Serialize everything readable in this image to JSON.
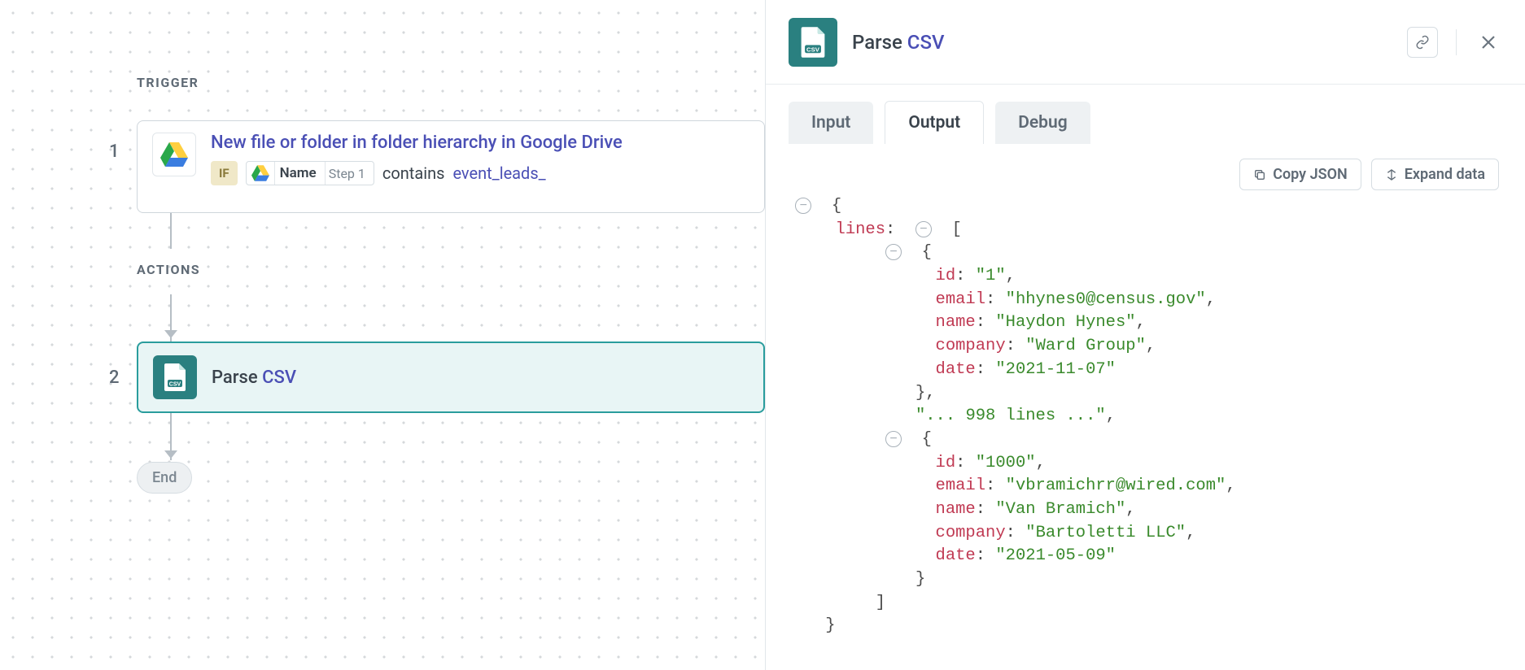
{
  "canvas": {
    "sectionTrigger": "TRIGGER",
    "sectionActions": "ACTIONS",
    "step1Num": "1",
    "step2Num": "2",
    "end": "End"
  },
  "trigger": {
    "title": "New file or folder in folder hierarchy in Google Drive",
    "ifLabel": "IF",
    "fieldName": "Name",
    "fieldStep": "Step 1",
    "operator": "contains",
    "value": "event_leads_"
  },
  "action": {
    "titlePrefix": "Parse ",
    "titleLink": "CSV"
  },
  "panel": {
    "titlePrefix": "Parse ",
    "titleLink": "CSV",
    "tabs": {
      "input": "Input",
      "output": "Output",
      "debug": "Debug"
    },
    "buttons": {
      "copyJson": "Copy JSON",
      "expandData": "Expand data"
    }
  },
  "output": {
    "linesKey": "lines",
    "truncatedMsg": "... 998 lines ...",
    "records": [
      {
        "id": "1",
        "email": "hhynes0@census.gov",
        "name": "Haydon Hynes",
        "company": "Ward Group",
        "date": "2021-11-07"
      },
      {
        "id": "1000",
        "email": "vbramichrr@wired.com",
        "name": "Van Bramich",
        "company": "Bartoletti LLC",
        "date": "2021-05-09"
      }
    ],
    "keys": {
      "id": "id",
      "email": "email",
      "name": "name",
      "company": "company",
      "date": "date"
    }
  }
}
